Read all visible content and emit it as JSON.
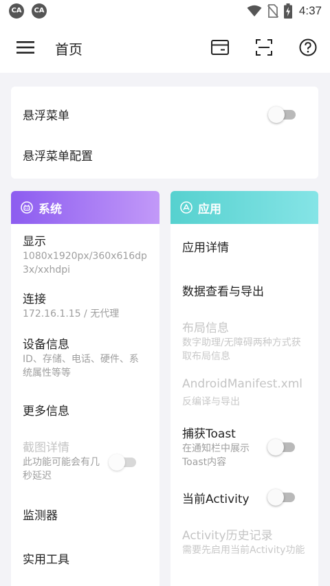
{
  "status_bar": {
    "time": "4:37",
    "left_icons": [
      "app-notification-icon",
      "app-notification-icon"
    ],
    "right_icons": [
      "wifi-icon",
      "no-sim-icon",
      "battery-charging-icon"
    ]
  },
  "toolbar": {
    "title": "首页",
    "icons": [
      "menu-icon",
      "card-icon",
      "scan-icon",
      "help-icon"
    ]
  },
  "float_menu": {
    "toggle_label": "悬浮菜单",
    "toggle_on": false,
    "config_label": "悬浮菜单配置"
  },
  "system": {
    "header": "系统",
    "header_colors": [
      "#8c5cf0",
      "#c299f8"
    ],
    "items": [
      {
        "title": "显示",
        "subtitle": "1080x1920px/360x616dp3x/xxhdpi"
      },
      {
        "title": "连接",
        "subtitle": "172.16.1.15 / 无代理"
      },
      {
        "title": "设备信息",
        "subtitle": "ID、存储、电话、硬件、系统属性等等"
      },
      {
        "title": "更多信息"
      },
      {
        "title": "截图详情",
        "subtitle": "此功能可能会有几秒延迟",
        "toggle_on": false,
        "disabled": true
      },
      {
        "title": "监测器"
      },
      {
        "title": "实用工具"
      }
    ]
  },
  "apps": {
    "header": "应用",
    "header_colors": [
      "#56d1cf",
      "#85e4e6"
    ],
    "items": [
      {
        "title": "应用详情"
      },
      {
        "title": "数据查看与导出"
      },
      {
        "title": "布局信息",
        "subtitle": "数字助理/无障碍两种方式获取布局信息",
        "disabled": true
      },
      {
        "title": "AndroidManifest.xml",
        "subtitle": "反编译与导出",
        "disabled": true
      },
      {
        "title": "捕获Toast",
        "subtitle": "在通知栏中展示Toast内容",
        "toggle_on": false
      },
      {
        "title": "当前Activity",
        "toggle_on": false
      },
      {
        "title": "Activity历史记录",
        "subtitle": "需要先启用当前Activity功能",
        "disabled": true
      }
    ]
  }
}
